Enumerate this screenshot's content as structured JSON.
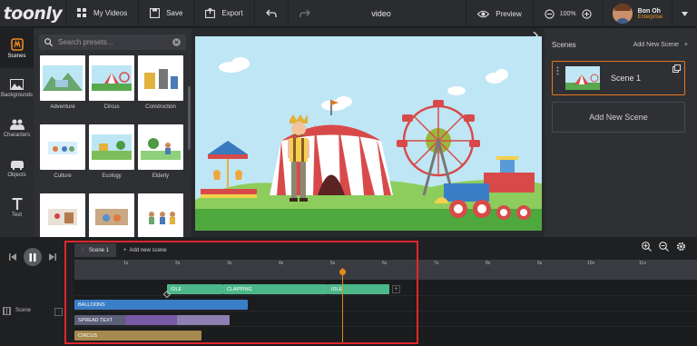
{
  "app": {
    "logo": "toonly",
    "title": "video"
  },
  "toolbar": {
    "my_videos": "My Videos",
    "save": "Save",
    "export": "Export",
    "preview": "Preview",
    "zoom": "100%"
  },
  "user": {
    "name": "Bon Oh",
    "plan": "Enterprise"
  },
  "rail": {
    "items": [
      {
        "label": "Scenes",
        "icon": "scenes-icon"
      },
      {
        "label": "Backgrounds",
        "icon": "image-icon"
      },
      {
        "label": "Characters",
        "icon": "characters-icon"
      },
      {
        "label": "Objects",
        "icon": "objects-icon"
      },
      {
        "label": "Text",
        "icon": "text-icon"
      }
    ]
  },
  "presets": {
    "placeholder": "Search presets...",
    "items": [
      {
        "label": "Adventure"
      },
      {
        "label": "Circus"
      },
      {
        "label": "Construction"
      },
      {
        "label": "Culture"
      },
      {
        "label": "Ecology"
      },
      {
        "label": "Elderly"
      },
      {
        "label": ""
      },
      {
        "label": ""
      },
      {
        "label": ""
      }
    ]
  },
  "scenes_panel": {
    "title": "Scenes",
    "add_link": "Add New Scene",
    "scene_name": "Scene 1",
    "add_button": "Add New Scene"
  },
  "timeline": {
    "tab": "Scene 1",
    "add_scene": "Add new scene",
    "track_label": "Scene",
    "ticks": [
      "1s",
      "2s",
      "3s",
      "4s",
      "5s",
      "6s",
      "7s",
      "8s",
      "9s",
      "10s",
      "11s"
    ],
    "clips": {
      "idle1": "IDLE",
      "clapping": "CLAPPING",
      "idle2": "IDLE",
      "balloons": "BALLOONS",
      "spread_text": "SPREAD TEXT",
      "circus": "CIRCUS"
    }
  },
  "colors": {
    "accent": "#e6781e",
    "clip_green": "#4cb889",
    "clip_blue": "#3b7ec8",
    "clip_purple": "#7a5aa6",
    "clip_olive": "#a5894e",
    "highlight": "#e0262b"
  }
}
